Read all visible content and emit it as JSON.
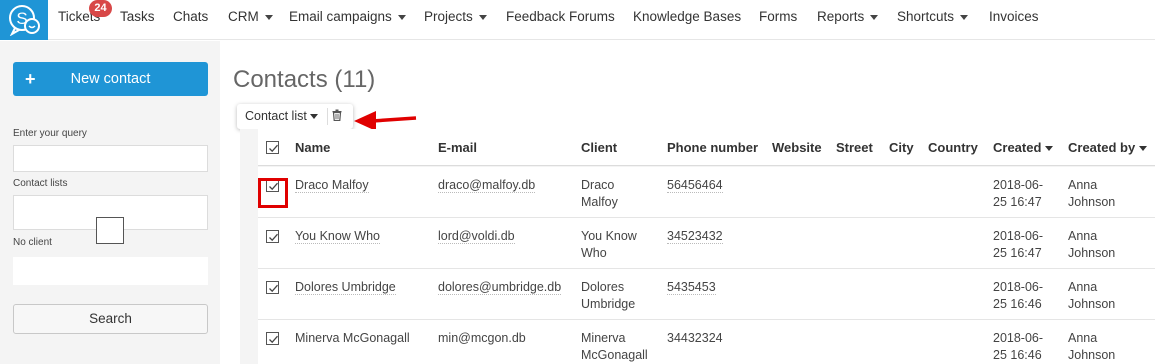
{
  "nav": {
    "items": [
      "Tickets",
      "Tasks",
      "Chats",
      "CRM",
      "Email campaigns",
      "Projects",
      "Feedback Forums",
      "Knowledge Bases",
      "Forms",
      "Reports",
      "Shortcuts",
      "Invoices"
    ],
    "tickets_badge": "24",
    "dropdown_items": [
      "CRM",
      "Email campaigns",
      "Projects",
      "Reports",
      "Shortcuts"
    ]
  },
  "sidebar": {
    "new_contact": "New contact",
    "query_label": "Enter your query",
    "query_value": "",
    "lists_label": "Contact lists",
    "lists_value": "",
    "no_client_label": "No client",
    "search_button": "Search"
  },
  "page": {
    "title": "Contacts (11)",
    "toolbar_list": "Contact list"
  },
  "table": {
    "columns": [
      "Name",
      "E-mail",
      "Client",
      "Phone number",
      "Website",
      "Street",
      "City",
      "Country",
      "Created",
      "Created by"
    ],
    "rows": [
      {
        "name": "Draco Malfoy",
        "email": "draco@malfoy.db",
        "client1": "Draco",
        "client2": "Malfoy",
        "phone": "56456464",
        "created1": "2018-06-",
        "created2": "25 16:47",
        "by1": "Anna",
        "by2": "Johnson"
      },
      {
        "name": "You Know Who",
        "email": "lord@voldi.db",
        "client1": "You Know",
        "client2": "Who",
        "phone": "34523432",
        "created1": "2018-06-",
        "created2": "25 16:47",
        "by1": "Anna",
        "by2": "Johnson"
      },
      {
        "name": "Dolores Umbridge",
        "email": "dolores@umbridge.db",
        "client1": "Dolores",
        "client2": "Umbridge",
        "phone": "5435453",
        "created1": "2018-06-",
        "created2": "25 16:46",
        "by1": "Anna",
        "by2": "Johnson"
      },
      {
        "name": "Minerva McGonagall",
        "email": "min@mcgon.db",
        "client1": "Minerva",
        "client2": "McGonagall",
        "phone": "34432324",
        "created1": "2018-06-",
        "created2": "25 16:46",
        "by1": "Anna",
        "by2": "Johnson"
      }
    ]
  },
  "colors": {
    "accent": "#1f95d6",
    "badge": "#d84848",
    "annotation": "#e00000"
  },
  "icons": {
    "logo": "support-chat-logo",
    "trash": "trash-icon",
    "arrow": "red-arrow-annotation",
    "check": "checkmark-icon"
  }
}
